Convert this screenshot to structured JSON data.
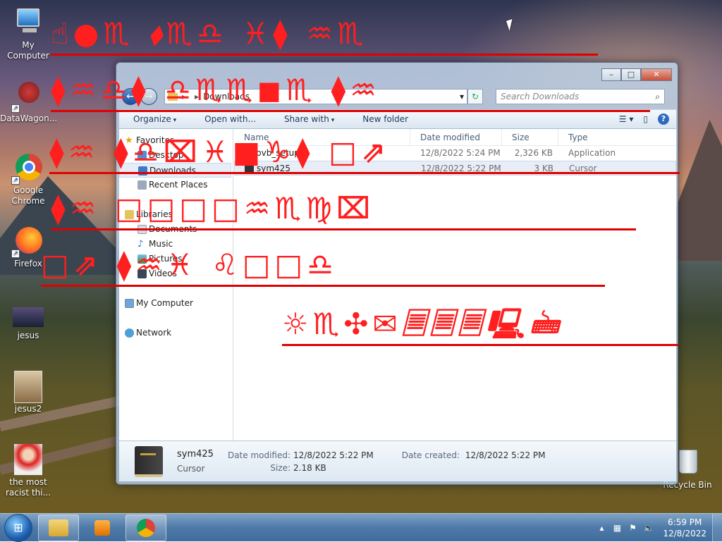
{
  "desktop": {
    "icons": [
      {
        "label": "My Computer"
      },
      {
        "label": "DataWagon..."
      },
      {
        "label": "Google Chrome"
      },
      {
        "label": "Firefox"
      },
      {
        "label": "jesus"
      },
      {
        "label": "jesus2"
      },
      {
        "label": "the most racist thi..."
      },
      {
        "label": "Recycle Bin"
      }
    ]
  },
  "explorer": {
    "address": {
      "root_label": "",
      "path_label": "Downloads"
    },
    "search": {
      "placeholder": "Search Downloads"
    },
    "toolbar": {
      "organize": "Organize",
      "open_with": "Open with...",
      "share_with": "Share with",
      "new_folder": "New folder"
    },
    "nav": {
      "favorites": "Favorites",
      "fav_items": [
        "Desktop",
        "Downloads",
        "Recent Places"
      ],
      "libraries": "Libraries",
      "lib_items": [
        "Documents",
        "Music",
        "Pictures",
        "Videos"
      ],
      "my_computer": "My Computer",
      "network": "Network"
    },
    "columns": {
      "name": "Name",
      "date": "Date modified",
      "size": "Size",
      "type": "Type"
    },
    "files": [
      {
        "name": "bvb_setup",
        "date": "12/8/2022 5:24 PM",
        "size": "2,326 KB",
        "type": "Application"
      },
      {
        "name": "sym425",
        "date": "12/8/2022 5:22 PM",
        "size": "3 KB",
        "type": "Cursor"
      }
    ],
    "details": {
      "name": "sym425",
      "type": "Cursor",
      "date_modified_label": "Date modified:",
      "date_modified": "12/8/2022 5:22 PM",
      "date_created_label": "Date created:",
      "date_created": "12/8/2022 5:22 PM",
      "size_label": "Size:",
      "size": "2.18 KB"
    }
  },
  "overlay": {
    "color": "#ff1f1f",
    "lines": [
      "☝●♏︎ ⬧♏︎♎ ♓︎⧫ ♒︎♏︎",
      "⧫♒︎♎⧫ ♎♏︎♏︎◼︎♏︎ ⧫♒︎",
      "⧫♒︎ ⧫♎⌧♓︎■♑︎⧫ □⇗",
      "⧫♒︎ □□□□♒︎♏︎♍⌧",
      "□⇗ ⧫♒︎♓︎ ♌□□♎",
      "☼♏︎✣✉🗏🗏🗏🖳🖮"
    ]
  },
  "taskbar": {
    "clock_time": "6:59 PM",
    "clock_date": "12/8/2022"
  }
}
